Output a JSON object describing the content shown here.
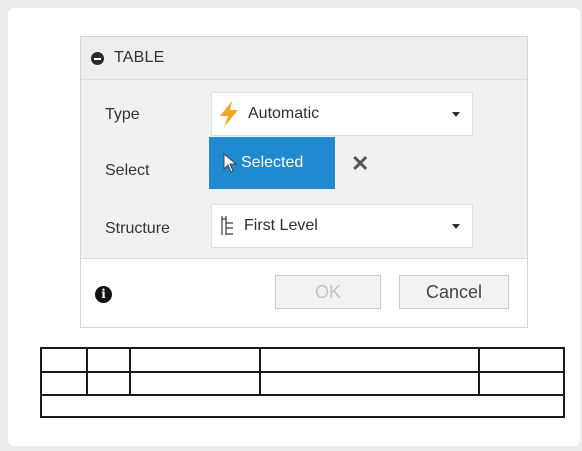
{
  "dialog": {
    "title": "TABLE",
    "type": {
      "label": "Type",
      "value": "Automatic",
      "icon": "lightning-bolt-icon"
    },
    "select": {
      "label": "Select",
      "value": "Selected",
      "icon": "cursor-arrow-icon",
      "clear_icon": "close-x-icon"
    },
    "structure": {
      "label": "Structure",
      "value": "First Level",
      "icon": "tree-structure-icon"
    },
    "footer": {
      "info_glyph": "i",
      "ok_label": "OK",
      "cancel_label": "Cancel"
    }
  },
  "colors": {
    "accent": "#1f8ad0",
    "bolt": "#f5a623"
  }
}
